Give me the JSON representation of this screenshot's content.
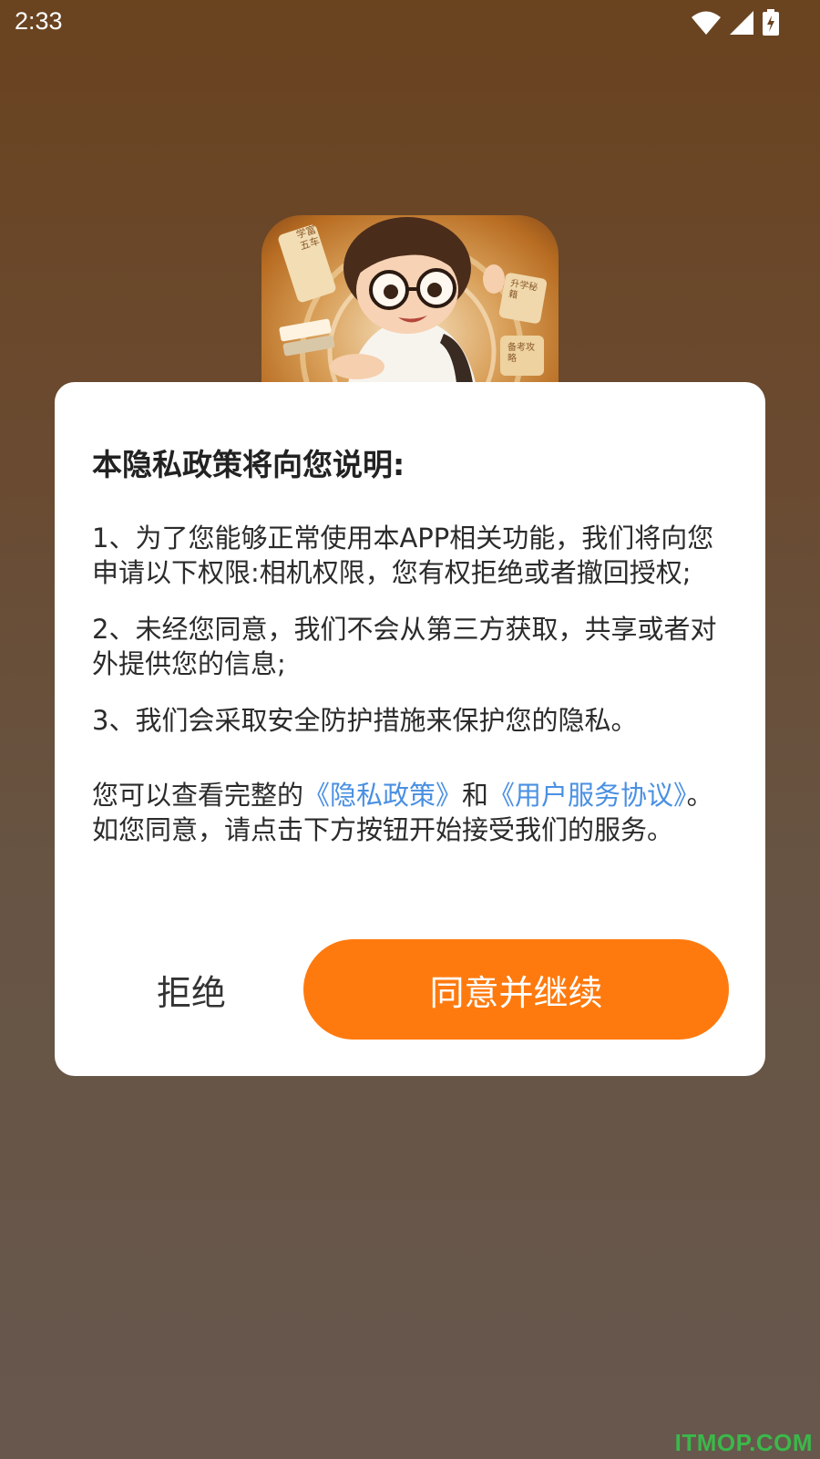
{
  "status_bar": {
    "time": "2:33",
    "icons": [
      "wifi-icon",
      "cell-signal-icon",
      "battery-charging-icon"
    ]
  },
  "app_icon": {
    "scroll_text_1": "学富五车",
    "scroll_text_2": "升学秘籍",
    "scroll_text_3": "备考攻略"
  },
  "dialog": {
    "title": "本隐私政策将向您说明:",
    "paragraphs": [
      "1、为了您能够正常使用本APP相关功能，我们将向您申请以下权限:相机权限，您有权拒绝或者撤回授权;",
      "2、未经您同意，我们不会从第三方获取，共享或者对外提供您的信息;",
      "3、我们会采取安全防护措施来保护您的隐私。"
    ],
    "notice": {
      "prefix": "您可以查看完整的",
      "privacy_link": "《隐私政策》",
      "middle": "和",
      "terms_link": "《用户服务协议》",
      "suffix": "。如您同意，请点击下方按钮开始接受我们的服务。"
    },
    "reject_label": "拒绝",
    "accept_label": "同意并继续"
  },
  "watermark": "ITMOP.COM",
  "colors": {
    "accent": "#ff7a0e",
    "link": "#4a90e2",
    "watermark": "#3bb84a"
  }
}
